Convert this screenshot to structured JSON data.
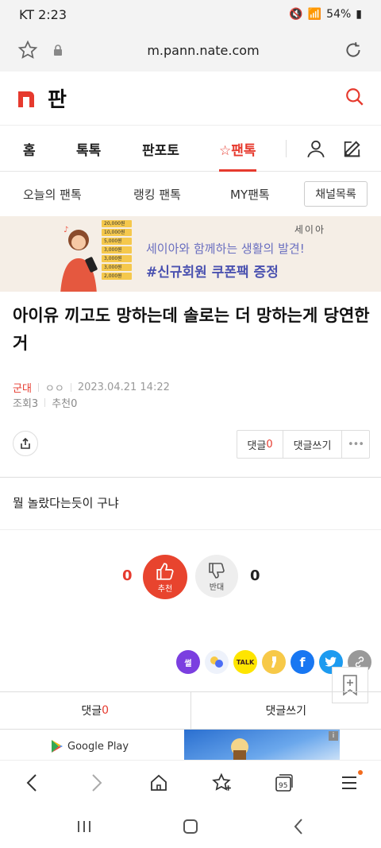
{
  "status": {
    "carrier_time": "KT 2:23",
    "battery": "54%"
  },
  "browser": {
    "url": "m.pann.nate.com"
  },
  "brand": {
    "title": "판"
  },
  "gnb": {
    "tabs": [
      "홈",
      "톡톡",
      "판포토",
      "☆팬톡"
    ],
    "active_index": 3
  },
  "subnav": {
    "items": [
      "오늘의 팬톡",
      "랭킹 팬톡",
      "MY팬톡"
    ],
    "channel_button": "채널목록"
  },
  "banner": {
    "brand": "세이아",
    "line1": "세이아와 함께하는 생활의 발견!",
    "line2": "#신규회원 쿠폰팩 증정",
    "coupons": [
      "20,000원",
      "10,000원",
      "5,000원",
      "3,000원",
      "3,000원",
      "3,000원",
      "2,000원"
    ]
  },
  "post": {
    "title": "아이유 끼고도 망하는데 솔로는 더 망하는게 당연한 거",
    "category": "군대",
    "author": "ㅇㅇ",
    "date": "2023.04.21 14:22",
    "views": "조회3",
    "recommends": "추천0",
    "body": "뭘 놀랐다는듯이 구냐"
  },
  "actions": {
    "comment_label": "댓글",
    "comment_count": "0",
    "write_comment": "댓글쓰기",
    "more": "•••"
  },
  "vote": {
    "up_count": "0",
    "up_label": "추천",
    "down_count": "0",
    "down_label": "반대"
  },
  "sns": {
    "items": [
      "썰",
      "",
      "TALK",
      "",
      "f",
      "",
      ""
    ]
  },
  "comment_bar": {
    "label": "댓글",
    "count": "0",
    "write": "댓글쓰기"
  },
  "ad": {
    "google_play": "Google Play",
    "info": "i"
  },
  "browser_nav": {
    "tabs_count": "95"
  },
  "colors": {
    "accent": "#e63a2e",
    "banner_text": "#4b52b0"
  }
}
